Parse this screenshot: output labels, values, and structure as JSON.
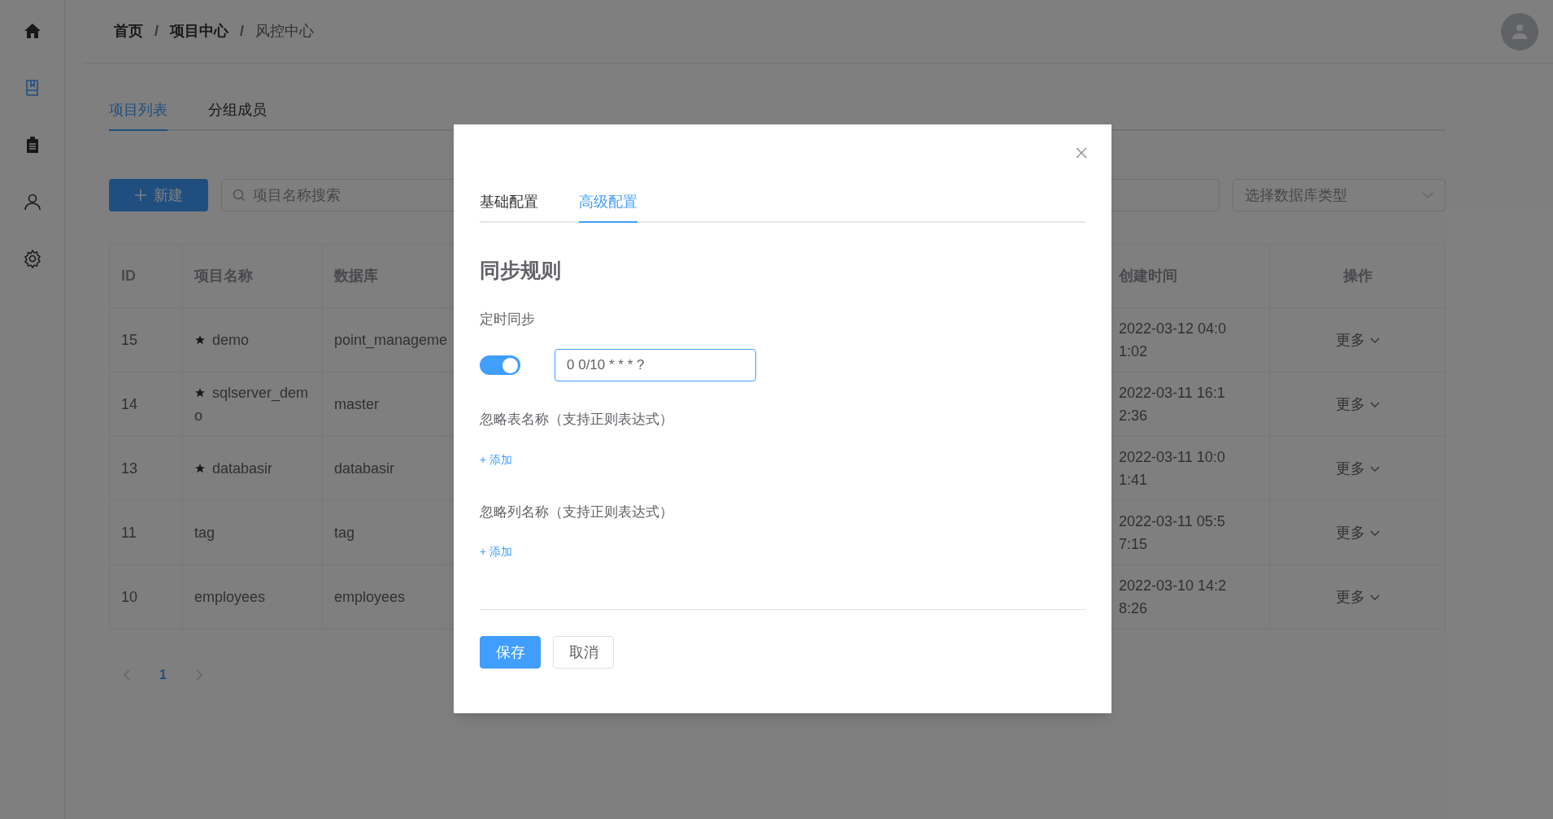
{
  "sidebar": {
    "items": [
      {
        "selected": false
      },
      {
        "selected": true
      },
      {
        "selected": false
      },
      {
        "selected": false
      },
      {
        "selected": false
      }
    ]
  },
  "breadcrumb": [
    {
      "label": "首页",
      "current": false
    },
    {
      "separator": "/",
      "label": "项目中心",
      "current": false
    },
    {
      "separator": "/",
      "label": "风控中心",
      "current": true
    }
  ],
  "tabs": [
    {
      "label": "项目列表",
      "selected": true
    },
    {
      "label": "分组成员",
      "selected": false
    }
  ],
  "toolbar": {
    "new_button": "新建",
    "search": {
      "placeholder": "项目名称搜索"
    },
    "select": {
      "placeholder": "选择数据库类型"
    }
  },
  "table": {
    "columns": [
      "ID",
      "项目名称",
      "数据库",
      "创建时间",
      "操作"
    ],
    "rows": [
      {
        "id": "15",
        "starred": true,
        "name": "demo",
        "database": "point_manageme",
        "created": "2022-03-12 04:01:02",
        "action": "更多"
      },
      {
        "id": "14",
        "starred": true,
        "name": "sqlserver_demo",
        "database": "master",
        "created": "2022-03-11 16:12:36",
        "action": "更多"
      },
      {
        "id": "13",
        "starred": true,
        "name": "databasir",
        "database": "databasir",
        "created": "2022-03-11 10:01:41",
        "action": "更多"
      },
      {
        "id": "11",
        "starred": false,
        "name": "tag",
        "database": "tag",
        "created": "2022-03-11 05:57:15",
        "action": "更多"
      },
      {
        "id": "10",
        "starred": false,
        "name": "employees",
        "database": "employees",
        "created": "2022-03-10 14:28:26",
        "action": "更多"
      }
    ]
  },
  "pagination": {
    "pages": [
      {
        "label": "1",
        "selected": true
      }
    ]
  },
  "modal": {
    "tabs": [
      {
        "label": "基础配置",
        "selected": false
      },
      {
        "label": "高级配置",
        "selected": true
      }
    ],
    "heading": "同步规则",
    "schedule": {
      "label": "定时同步",
      "on": true,
      "value": "0 0/10 * * * ?"
    },
    "sections": [
      {
        "label": "忽略表名称（支持正则表达式）",
        "add_label": "+ 添加"
      },
      {
        "label": "忽略列名称（支持正则表达式）",
        "add_label": "+ 添加"
      }
    ],
    "buttons": [
      {
        "label": "保存",
        "kind": "primary"
      },
      {
        "label": "取消",
        "kind": "default"
      }
    ]
  }
}
